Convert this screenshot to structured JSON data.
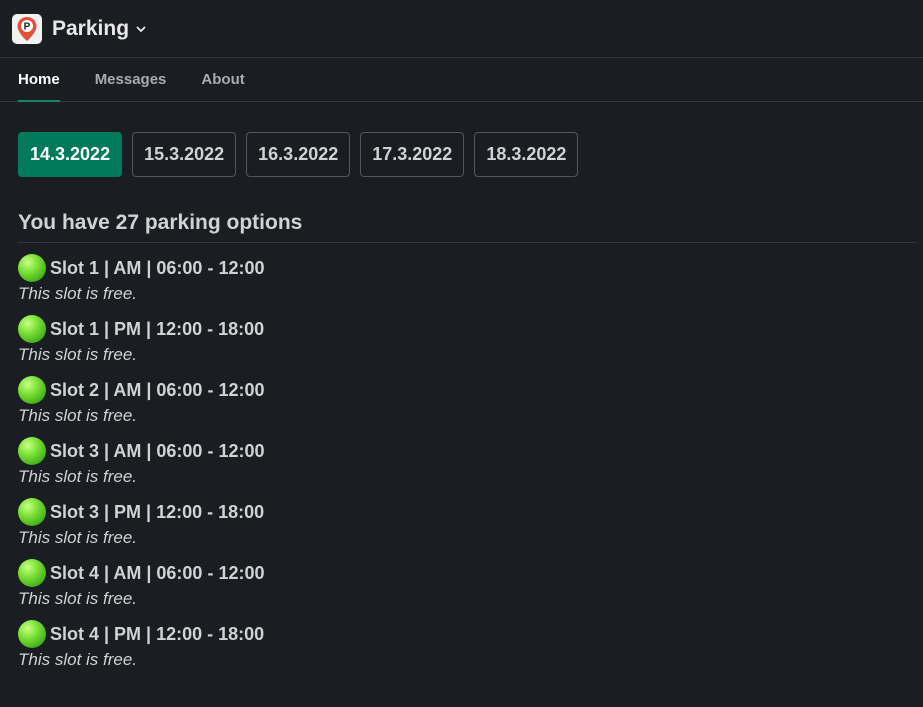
{
  "app": {
    "title": "Parking",
    "logo_letter": "P",
    "logo_icon": "map-pin-icon"
  },
  "tabs": [
    {
      "label": "Home",
      "active": true
    },
    {
      "label": "Messages",
      "active": false
    },
    {
      "label": "About",
      "active": false
    }
  ],
  "dates": [
    {
      "label": "14.3.2022",
      "selected": true
    },
    {
      "label": "15.3.2022",
      "selected": false
    },
    {
      "label": "16.3.2022",
      "selected": false
    },
    {
      "label": "17.3.2022",
      "selected": false
    },
    {
      "label": "18.3.2022",
      "selected": false
    }
  ],
  "summary": "You have 27 parking options",
  "slots": [
    {
      "title": "Slot 1 | AM | 06:00 - 12:00",
      "status": "This slot is free."
    },
    {
      "title": "Slot 1 | PM | 12:00 - 18:00",
      "status": "This slot is free."
    },
    {
      "title": "Slot 2 | AM | 06:00 - 12:00",
      "status": "This slot is free."
    },
    {
      "title": "Slot 3 | AM | 06:00 - 12:00",
      "status": "This slot is free."
    },
    {
      "title": "Slot 3 | PM | 12:00 - 18:00",
      "status": "This slot is free."
    },
    {
      "title": "Slot 4 | AM | 06:00 - 12:00",
      "status": "This slot is free."
    },
    {
      "title": "Slot 4 | PM | 12:00 - 18:00",
      "status": "This slot is free."
    }
  ],
  "colors": {
    "background": "#1a1d21",
    "accent": "#007a5a",
    "free_indicator": "#7ee33a",
    "logo_pin": "#e0533a"
  }
}
